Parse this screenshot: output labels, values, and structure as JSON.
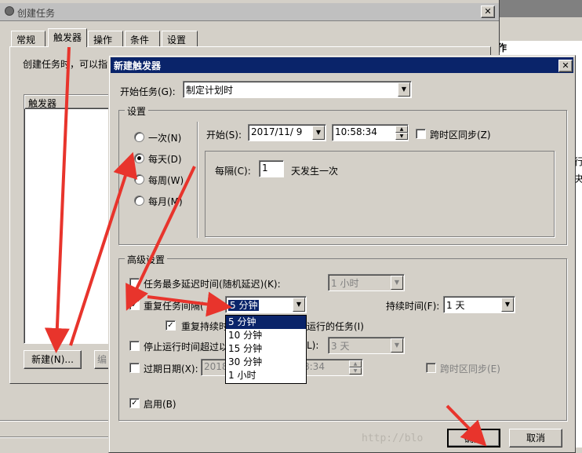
{
  "outer_window": {
    "title": "创建任务",
    "tabs": [
      "常规",
      "触发器",
      "操作",
      "条件",
      "设置"
    ],
    "description": "创建任务时，可以指",
    "list_header": "触发器",
    "new_button": "新建(N)...",
    "edit_button": "编"
  },
  "background_window": {
    "header_fragment": "作",
    "side_fragments": [
      "行",
      "夬"
    ]
  },
  "dialog": {
    "title": "新建触发器",
    "begin_task_label": "开始任务(G):",
    "begin_task_value": "制定计划时",
    "settings_group": "设置",
    "schedule_options": [
      {
        "label": "一次(N)",
        "selected": false
      },
      {
        "label": "每天(D)",
        "selected": true
      },
      {
        "label": "每周(W)",
        "selected": false
      },
      {
        "label": "每月(M)",
        "selected": false
      }
    ],
    "start_label": "开始(S):",
    "start_date": "2017/11/ 9",
    "start_time": "10:58:34",
    "sync_timezone_label": "跨时区同步(Z)",
    "recur_label": "每隔(C):",
    "recur_value": "1",
    "recur_suffix": "天发生一次",
    "advanced_group": "高级设置",
    "delay_label": "任务最多延迟时间(随机延迟)(K):",
    "delay_value": "1 小时",
    "repeat_label": "重复任务间隔(",
    "repeat_value": "5 分钟",
    "duration_label": "持续时间(F):",
    "duration_value": "1 天",
    "repeat_stop_label": "重复持续时",
    "repeat_stop_suffix": "运行的任务(I)",
    "stop_label": "停止运行时间超过以",
    "stop_label_suffix": "L):",
    "stop_value": "3 天",
    "expire_label": "过期日期(X):",
    "expire_date": "2018",
    "expire_time": "8:34",
    "expire_sync_label": "跨时区同步(E)",
    "enabled_label": "启用(B)",
    "ok_button": "确定",
    "cancel_button": "取消",
    "watermark": "http://blo",
    "dropdown_options": [
      "5 分钟",
      "10 分钟",
      "15 分钟",
      "30 分钟",
      "1 小时"
    ],
    "dropdown_selected_index": 0
  },
  "colors": {
    "title_active": "#0a246a",
    "title_inactive": "#808080",
    "annotation_arrow": "#e8342c"
  }
}
